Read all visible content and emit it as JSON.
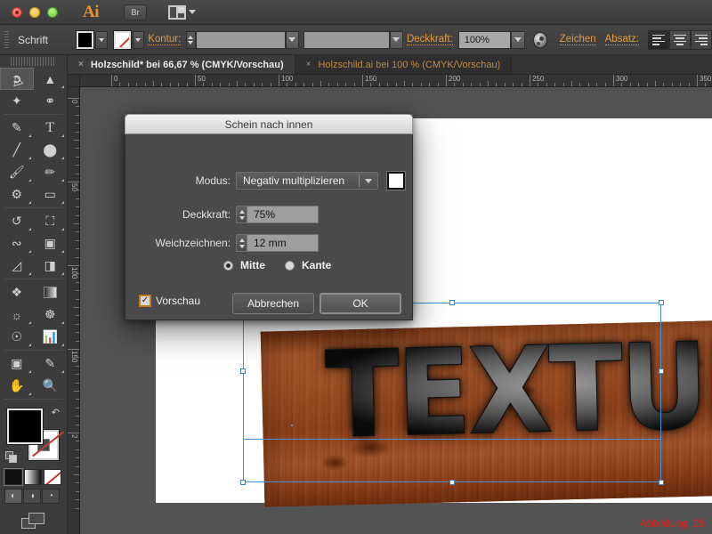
{
  "titlebar": {
    "app_logo": "Ai",
    "bridge_button": "Br",
    "workspace_icon": "workspace-layout-icon",
    "traffic_lights": [
      "close",
      "minimize",
      "zoom"
    ]
  },
  "controlbar": {
    "context_title": "Schrift",
    "fill_label": "fill-swatch",
    "stroke_swatch_label": "stroke-none-swatch",
    "kontur_label": "Kontur:",
    "kontur_weight_value": "",
    "kontur_profile_value": "",
    "deckkraft_label": "Deckkraft:",
    "deckkraft_value": "100%",
    "recolor_icon": "recolor-artwork-icon",
    "zeichen_label": "Zeichen",
    "absatz_label": "Absatz:",
    "align_buttons": [
      "align-left",
      "align-center",
      "align-right"
    ]
  },
  "tabs": [
    {
      "label": "Holzschild* bei 66,67 % (CMYK/Vorschau)",
      "active": true,
      "close": "×"
    },
    {
      "label": "Holzschild.ai bei 100 % (CMYK/Vorschau)",
      "active": false,
      "close": "×"
    }
  ],
  "rulers": {
    "horizontal_labels": [
      "0",
      "50",
      "100",
      "150",
      "200",
      "250",
      "300",
      "350"
    ],
    "vertical_labels": [
      "0",
      "50",
      "100",
      "150",
      "2"
    ],
    "unit": "mm"
  },
  "tools": {
    "column_left": [
      "selection-tool",
      "magic-wand-tool",
      "pen-tool",
      "line-segment-tool",
      "paintbrush-tool",
      "blob-brush-tool",
      "rotate-tool",
      "width-tool",
      "shape-builder-tool",
      "perspective-grid-tool",
      "eyedropper-tool",
      "symbol-sprayer-tool",
      "artboard-tool",
      "hand-tool"
    ],
    "column_right": [
      "direct-selection-tool",
      "lasso-tool",
      "type-tool",
      "ellipse-tool",
      "pencil-tool",
      "eraser-tool",
      "scale-tool",
      "free-transform-tool",
      "gradient-tool",
      "column-graph-tool",
      "blend-tool",
      "slice-tool",
      "zoom-tool"
    ],
    "selected": "selection-tool",
    "fill_color": "#000000",
    "stroke_color": "none",
    "color_modes": [
      "solid-color",
      "gradient",
      "none"
    ],
    "draw_modes": [
      "draw-normal",
      "draw-behind",
      "draw-inside"
    ],
    "screen_mode": "change-screen-mode"
  },
  "dialog": {
    "title": "Schein nach innen",
    "modus_label": "Modus:",
    "modus_value": "Negativ multiplizieren",
    "modus_swatch_color": "#ffffff",
    "deckkraft_label": "Deckkraft:",
    "deckkraft_value": "75%",
    "weichzeichnen_label": "Weichzeichnen:",
    "weichzeichnen_value": "12 mm",
    "radio_options": [
      {
        "label": "Mitte",
        "selected": true
      },
      {
        "label": "Kante",
        "selected": false
      }
    ],
    "vorschau_label": "Vorschau",
    "vorschau_checked": true,
    "cancel_button": "Abbrechen",
    "ok_button": "OK"
  },
  "artwork": {
    "text": "TEXTUR",
    "plank_color": "#9e4d22",
    "text_color": "#3a3a3a",
    "selection_color": "#4a90d9"
  },
  "caption": {
    "text": "Abbildung: 25",
    "color": "#e8201c"
  }
}
